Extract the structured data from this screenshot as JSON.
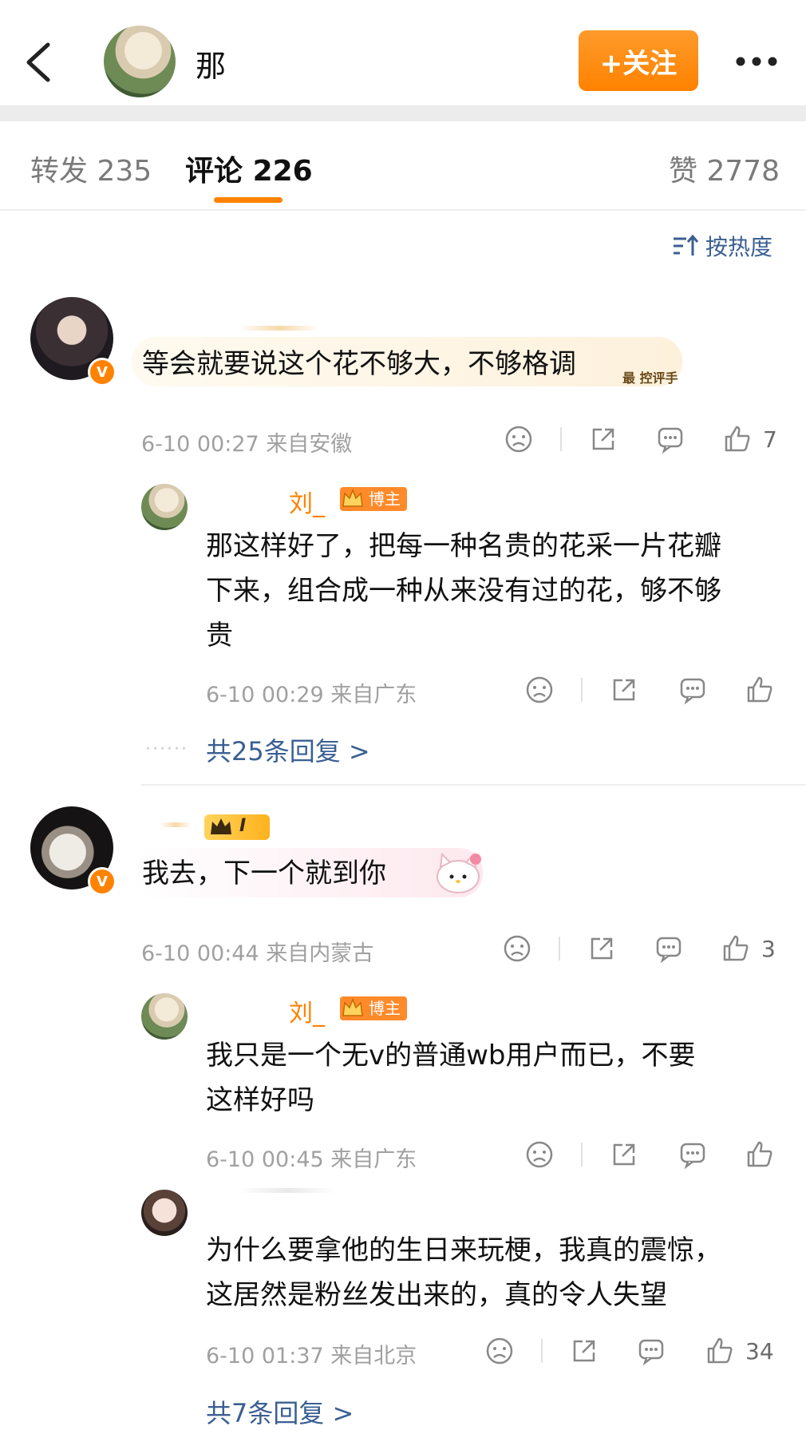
{
  "header": {
    "name": "那",
    "follow_label": "+关注",
    "colors": {
      "accent": "#ff8200",
      "link": "#3a5f92"
    }
  },
  "tabs": [
    {
      "label": "转发",
      "count": "235"
    },
    {
      "label": "评论",
      "count": "226"
    },
    {
      "label": "赞",
      "count": "2778"
    }
  ],
  "sort_label": "按热度",
  "comments": [
    {
      "text": "等会就要说这个花不够大，不够格调",
      "badge_text": "最 控评手",
      "time": "6-10 00:27",
      "location": "来自安徽",
      "likes": "7",
      "replies": [
        {
          "name": "刘_",
          "badge": "博主",
          "text_lines": [
            "那这样好了，把每一种名贵的花采一片花瓣",
            "下来，组合成一种从来没有过的花，够不够",
            "贵"
          ],
          "time": "6-10 00:29",
          "location": "来自广东"
        }
      ],
      "more_replies": "共25条回复 >"
    },
    {
      "level_badge": "I",
      "text": "我去，下一个就到你",
      "time": "6-10 00:44",
      "location": "来自内蒙古",
      "likes": "3",
      "replies": [
        {
          "name": "刘_",
          "badge": "博主",
          "text_lines": [
            "我只是一个无v的普通wb用户而已，不要",
            "这样好吗"
          ],
          "time": "6-10 00:45",
          "location": "来自广东"
        },
        {
          "text_lines": [
            "为什么要拿他的生日来玩梗，我真的震惊，",
            "这居然是粉丝发出来的，真的令人失望"
          ],
          "time": "6-10 01:37",
          "location": "来自北京",
          "likes": "34"
        }
      ],
      "more_replies": "共7条回复 >"
    }
  ]
}
